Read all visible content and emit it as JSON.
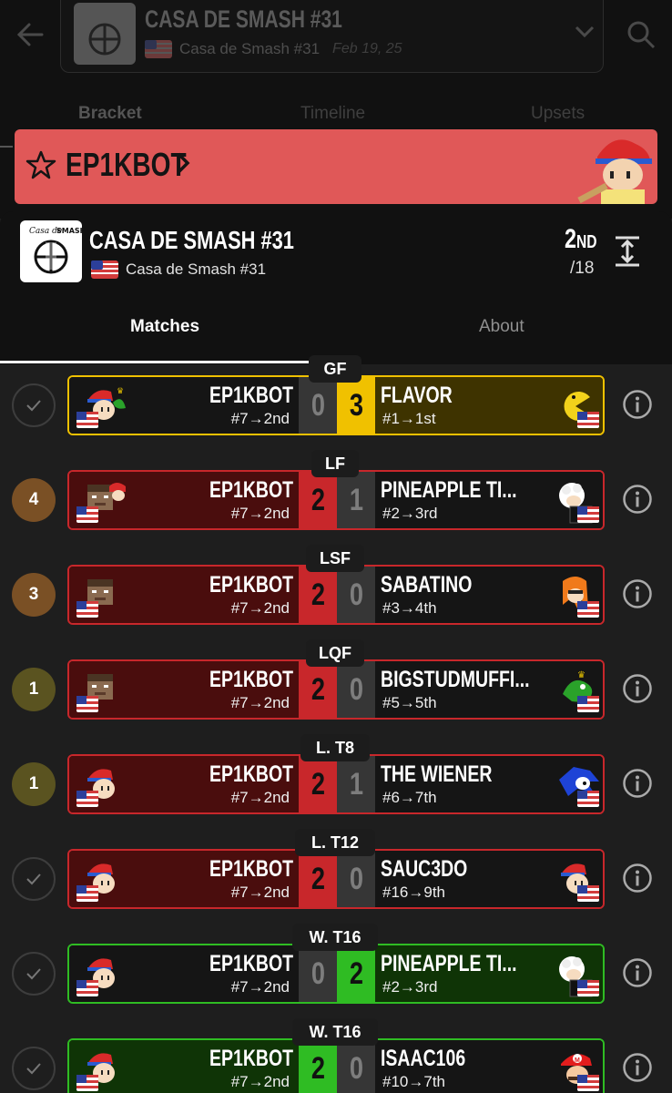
{
  "event": {
    "title": "CASA DE SMASH #31",
    "subtitle": "Casa de Smash #31",
    "date": "Feb 19, 25",
    "logo_text": "Casa de SMASH"
  },
  "bg_tabs": [
    "Bracket",
    "Timeline",
    "Upsets"
  ],
  "banner": {
    "player": "EP1KBOT"
  },
  "sheet": {
    "title": "CASA DE SMASH #31",
    "subtitle": "Casa de Smash #31",
    "place_num": "2",
    "place_suffix": "ND",
    "place_total": "/18",
    "tabs": [
      "Matches",
      "About"
    ]
  },
  "colors": {
    "loss": "#c8272b",
    "winner_gold": "#f0c100",
    "win": "#2fbc23"
  },
  "matches": [
    {
      "round": "GF",
      "status": "check",
      "p1": {
        "name": "EP1KBOT",
        "seed": "#7→2nd",
        "score": "0"
      },
      "p2": {
        "name": "FLAVOR",
        "seed": "#1→1st",
        "score": "3"
      },
      "result": "yellow"
    },
    {
      "round": "LF",
      "status": "4",
      "p1": {
        "name": "EP1KBOT",
        "seed": "#7→2nd",
        "score": "2"
      },
      "p2": {
        "name": "PINEAPPLE TI...",
        "seed": "#2→3rd",
        "score": "1"
      },
      "result": "red"
    },
    {
      "round": "LSF",
      "status": "3",
      "p1": {
        "name": "EP1KBOT",
        "seed": "#7→2nd",
        "score": "2"
      },
      "p2": {
        "name": "SABATINO",
        "seed": "#3→4th",
        "score": "0"
      },
      "result": "red"
    },
    {
      "round": "LQF",
      "status": "1",
      "p1": {
        "name": "EP1KBOT",
        "seed": "#7→2nd",
        "score": "2"
      },
      "p2": {
        "name": "BIGSTUDMUFFI...",
        "seed": "#5→5th",
        "score": "0"
      },
      "result": "red"
    },
    {
      "round": "L. T8",
      "status": "1",
      "p1": {
        "name": "EP1KBOT",
        "seed": "#7→2nd",
        "score": "2"
      },
      "p2": {
        "name": "THE WIENER",
        "seed": "#6→7th",
        "score": "1"
      },
      "result": "red"
    },
    {
      "round": "L. T12",
      "status": "check",
      "p1": {
        "name": "EP1KBOT",
        "seed": "#7→2nd",
        "score": "2"
      },
      "p2": {
        "name": "SAUC3DO",
        "seed": "#16→9th",
        "score": "0"
      },
      "result": "red"
    },
    {
      "round": "W. T16",
      "status": "check",
      "p1": {
        "name": "EP1KBOT",
        "seed": "#7→2nd",
        "score": "0"
      },
      "p2": {
        "name": "PINEAPPLE TI...",
        "seed": "#2→3rd",
        "score": "2"
      },
      "result": "green-right"
    },
    {
      "round": "W. T16",
      "status": "check",
      "p1": {
        "name": "EP1KBOT",
        "seed": "#7→2nd",
        "score": "2"
      },
      "p2": {
        "name": "ISAAC106",
        "seed": "#10→7th",
        "score": "0"
      },
      "result": "green-left"
    }
  ]
}
